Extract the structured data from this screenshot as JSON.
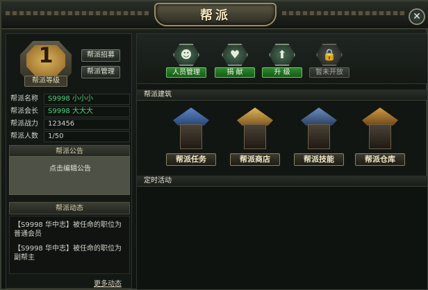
{
  "window": {
    "title": "帮派",
    "close_icon": "close-icon"
  },
  "left": {
    "level": {
      "number": "1",
      "label": "帮派等级"
    },
    "buttons": [
      {
        "label": "帮派招募"
      },
      {
        "label": "帮派管理"
      }
    ],
    "info": [
      {
        "label": "帮派名称",
        "value": "S9998 小小小"
      },
      {
        "label": "帮派会长",
        "value": "S9998 大大大"
      },
      {
        "label": "帮派战力",
        "value": "123456"
      },
      {
        "label": "帮派人数",
        "value": "1/50"
      }
    ],
    "notice": {
      "header": "帮派公告",
      "text": "点击编辑公告"
    },
    "dynamics": {
      "header": "帮派动态",
      "items": [
        {
          "line1": "【S9998 华中志】被任命的职位为",
          "line2": "普通会员"
        },
        {
          "line1": "【S9998 华中志】被任命的职位为",
          "line2": "副帮主"
        }
      ],
      "more": "更多动态"
    }
  },
  "right": {
    "functions": [
      {
        "label": "人员管理",
        "icon": "person-icon",
        "locked": false
      },
      {
        "label": "捐 献",
        "icon": "donate-icon",
        "locked": false
      },
      {
        "label": "升 级",
        "icon": "up-arrow-icon",
        "locked": false
      },
      {
        "label": "暂未开放",
        "icon": "lock-icon",
        "locked": true
      }
    ],
    "buildings_header": "帮派建筑",
    "buildings": [
      {
        "label": "帮派任务",
        "roof_color": "#3a5f9a"
      },
      {
        "label": "帮派商店",
        "roof_color": "#b48a3e"
      },
      {
        "label": "帮派技能",
        "roof_color": "#4a6b95"
      },
      {
        "label": "帮派仓库",
        "roof_color": "#b07a2e"
      }
    ],
    "events_header": "定时活动"
  }
}
